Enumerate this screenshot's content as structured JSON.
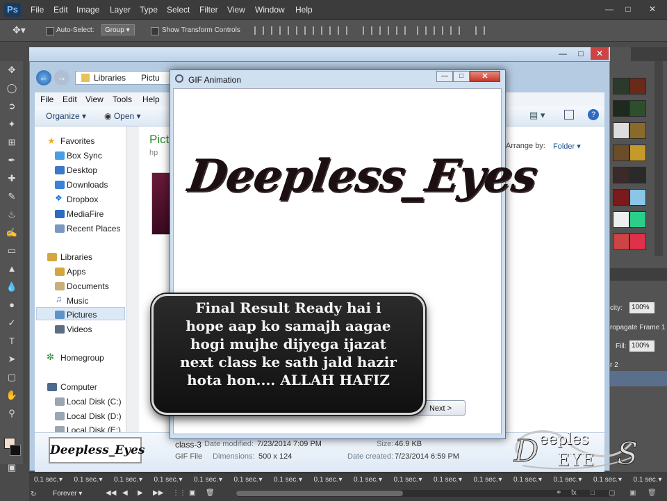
{
  "ps": {
    "logo": "Ps",
    "menu": [
      "File",
      "Edit",
      "Image",
      "Layer",
      "Type",
      "Select",
      "Filter",
      "View",
      "Window",
      "Help"
    ],
    "options": {
      "auto_select": "Auto-Select:",
      "group_value": "Group",
      "show_transform": "Show Transform Controls"
    },
    "right_panel": {
      "opacity_label": "city:",
      "opacity_value": "100%",
      "propagate": "ropagate Frame 1",
      "fill_label": "Fill:",
      "fill_value": "100%",
      "layer_label": "r 2"
    }
  },
  "explorer": {
    "breadcrumb": [
      "Libraries",
      "Pictu"
    ],
    "menu": [
      "File",
      "Edit",
      "View",
      "Tools",
      "Help"
    ],
    "toolbar": {
      "organize": "Organize",
      "open": "Open",
      "arrange_by": "Arrange by:",
      "arrange_value": "Folder"
    },
    "main_title": "Pict",
    "main_sub": "hp",
    "nav": {
      "favorites": {
        "label": "Favorites",
        "items": [
          "Box Sync",
          "Desktop",
          "Downloads",
          "Dropbox",
          "MediaFire",
          "Recent Places"
        ]
      },
      "libraries": {
        "label": "Libraries",
        "items": [
          "Apps",
          "Documents",
          "Music",
          "Pictures",
          "Videos"
        ]
      },
      "homegroup": "Homegroup",
      "computer": {
        "label": "Computer",
        "items": [
          "Local Disk (C:)",
          "Local Disk (D:)",
          "Local Disk (E:)"
        ]
      }
    },
    "details": {
      "name": "class-3",
      "type": "GIF File",
      "modified_label": "Date modified:",
      "modified_value": "7/23/2014 7:09 PM",
      "dimensions_label": "Dimensions:",
      "dimensions_value": "500 x 124",
      "size_label": "Size:",
      "size_value": "46.9 KB",
      "created_label": "Date created:",
      "created_value": "7/23/2014 6:59 PM"
    }
  },
  "gif_window": {
    "title": "GIF Animation",
    "logo_text": "Deepless_Eyes",
    "next_button": "Next >"
  },
  "caption": {
    "lines": [
      "Final Result Ready hai i",
      "hope aap ko samajh aagae",
      "hogi mujhe dijyega ijazat",
      "next class ke sath jald hazir",
      "hota hon.... ALLAH HAFIZ"
    ]
  },
  "badge": {
    "text": "Deepless_Eyes"
  },
  "watermark": {
    "top": "eeples",
    "bottom": "EYE"
  },
  "timeline": {
    "delays": [
      "0.1 sec.",
      "0.1 sec.",
      "0.1 sec.",
      "0.1 sec.",
      "0.1 sec.",
      "0.1 sec.",
      "0.1 sec.",
      "0.1 sec.",
      "0.1 sec.",
      "0.1 sec.",
      "0.1 sec.",
      "0.1 sec.",
      "0.1 sec.",
      "0.1 sec.",
      "0.1 sec.",
      "0.1 sec."
    ],
    "loop": "Forever"
  },
  "colors": {
    "ps_dark": "#3c3c3c",
    "ps_panel": "#535353",
    "explorer_blue": "#b5cbe2",
    "link_blue": "#1e3f66"
  }
}
